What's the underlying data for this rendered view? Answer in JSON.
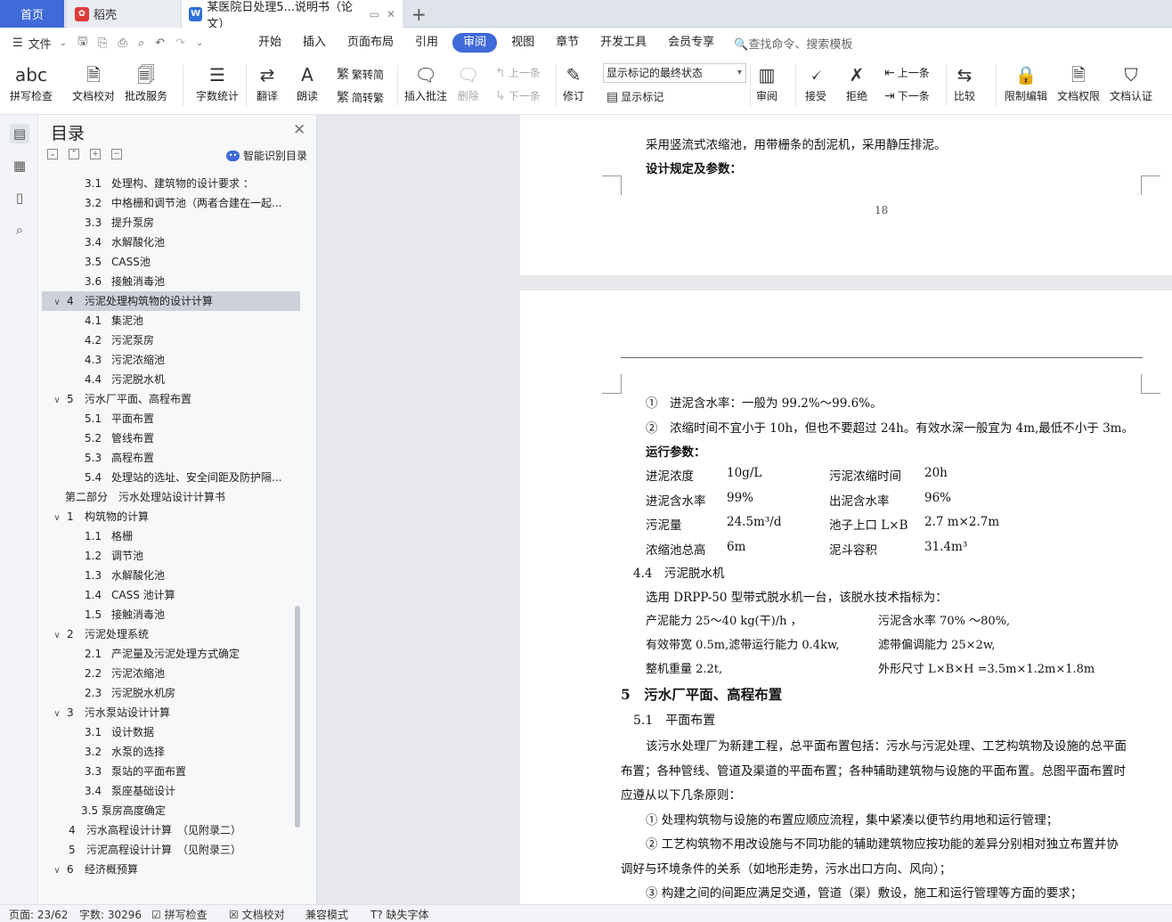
{
  "tabs": {
    "home": "首页",
    "daoke": "稻壳",
    "active": "某医院日处理5...说明书（论文）"
  },
  "menu": {
    "file": "文件",
    "items": [
      "开始",
      "插入",
      "页面布局",
      "引用",
      "审阅",
      "视图",
      "章节",
      "开发工具",
      "会员专享"
    ],
    "active_index": 4,
    "search": "查找命令、搜索模板"
  },
  "ribbon": {
    "spell": "拼写检查",
    "doc_check": "文档校对",
    "batch": "批改服务",
    "wordcount": "字数统计",
    "translate": "翻译",
    "read": "朗读",
    "t2s": "繁转简",
    "s2t": "简转繁",
    "insert_comment": "插入批注",
    "delete": "删除",
    "prev_comment": "上一条",
    "next_comment": "下一条",
    "revise": "修订",
    "markup_state": "显示标记的最终状态",
    "show_markup": "显示标记",
    "review": "审阅",
    "accept": "接受",
    "reject": "拒绝",
    "prev_change": "上一条",
    "next_change": "下一条",
    "compare": "比较",
    "restrict": "限制编辑",
    "permission": "文档权限",
    "certify": "文档认证"
  },
  "toc": {
    "title": "目录",
    "smart": "智能识别目录",
    "items": [
      {
        "num": "3.1",
        "text": "处理构、建筑物的设计要求 ：",
        "level": 3
      },
      {
        "num": "3.2",
        "text": "中格栅和调节池（两者合建在一起...",
        "level": 3
      },
      {
        "num": "3.3",
        "text": "提升泵房",
        "level": 3
      },
      {
        "num": "3.4",
        "text": "水解酸化池",
        "level": 3
      },
      {
        "num": "3.5",
        "text": "CASS池",
        "level": 3
      },
      {
        "num": "3.6",
        "text": "接触消毒池",
        "level": 3
      },
      {
        "num": "4",
        "text": "污泥处理构筑物的设计计算",
        "level": 2,
        "toggle": "v",
        "selected": true
      },
      {
        "num": "4.1",
        "text": "集泥池",
        "level": 3
      },
      {
        "num": "4.2",
        "text": "污泥泵房",
        "level": 3
      },
      {
        "num": "4.3",
        "text": "污泥浓缩池",
        "level": 3
      },
      {
        "num": "4.4",
        "text": "污泥脱水机",
        "level": 3
      },
      {
        "num": "5",
        "text": "污水厂平面、高程布置",
        "level": 2,
        "toggle": "v"
      },
      {
        "num": "5.1",
        "text": "平面布置",
        "level": 3
      },
      {
        "num": "5.2",
        "text": "管线布置",
        "level": 3
      },
      {
        "num": "5.3",
        "text": "高程布置",
        "level": 3
      },
      {
        "num": "5.4",
        "text": "处理站的选址、安全间距及防护隔...",
        "level": 3
      },
      {
        "num": "",
        "text": "第二部分　污水处理站设计计算书",
        "level": 1
      },
      {
        "num": "1",
        "text": "构筑物的计算",
        "level": 2,
        "toggle": "v"
      },
      {
        "num": "1.1",
        "text": "格栅",
        "level": 3
      },
      {
        "num": "1.2",
        "text": "调节池",
        "level": 3
      },
      {
        "num": "1.3",
        "text": "水解酸化池",
        "level": 3
      },
      {
        "num": "1.4",
        "text": "CASS 池计算",
        "level": 3
      },
      {
        "num": "1.5",
        "text": "接触消毒池",
        "level": 3
      },
      {
        "num": "2",
        "text": "污泥处理系统",
        "level": 2,
        "toggle": "v"
      },
      {
        "num": "2.1",
        "text": "产泥量及污泥处理方式确定",
        "level": 3
      },
      {
        "num": "2.2",
        "text": "污泥浓缩池",
        "level": 3
      },
      {
        "num": "2.3",
        "text": "污泥脱水机房",
        "level": 3
      },
      {
        "num": "3",
        "text": "污水泵站设计计算",
        "level": 2,
        "toggle": "v"
      },
      {
        "num": "3.1",
        "text": "设计数据",
        "level": 3
      },
      {
        "num": "3.2",
        "text": "水泵的选择",
        "level": 3
      },
      {
        "num": "3.3",
        "text": "泵站的平面布置",
        "level": 3
      },
      {
        "num": "3.4",
        "text": "泵座基础设计",
        "level": 3
      },
      {
        "num": "",
        "text": "3.5 泵房高度确定",
        "level": 3
      },
      {
        "num": "4",
        "text": "污水高程设计计算　（见附录二）",
        "level": 2
      },
      {
        "num": "5",
        "text": "污泥高程设计计算　（见附录三）",
        "level": 2
      },
      {
        "num": "6",
        "text": "经济概预算",
        "level": 2,
        "toggle": "v"
      }
    ]
  },
  "doc": {
    "p1": [
      "采用竖流式浓缩池，用带栅条的刮泥机，采用静压排泥。",
      "设计规定及参数："
    ],
    "page_number": "18",
    "l1": "①　进泥含水率：一般为 99.2%～99.6%。",
    "l2": "②　浓缩时间不宜小于 10h，但也不要超过 24h。有效水深一般宜为 4m,最低不小于 3m。",
    "l3": "运行参数：",
    "params": [
      [
        "进泥浓度",
        "10g/L",
        "污泥浓缩时间",
        "20h"
      ],
      [
        "进泥含水率",
        "99%",
        "出泥含水率",
        "96%"
      ],
      [
        "污泥量",
        "24.5m³/d",
        "池子上口 L×B",
        "2.7 m×2.7m"
      ],
      [
        "浓缩池总高",
        "6m",
        "泥斗容积",
        "31.4m³"
      ]
    ],
    "h44": "4.4　污泥脱水机",
    "d1": "选用 DRPP-50 型带式脱水机一台，该脱水技术指标为：",
    "specs": [
      [
        "产泥能力 25～40 kg(干)/h ，",
        "污泥含水率 70% ～80%,"
      ],
      [
        "有效带宽 0.5m,滤带运行能力 0.4kw,",
        "滤带偏调能力 25×2w,"
      ],
      [
        "整机重量 2.2t,",
        "外形尺寸 L×B×H =3.5m×1.2m×1.8m"
      ]
    ],
    "h5": "5　污水厂平面、高程布置",
    "h51": "5.1　平面布置",
    "para": [
      "该污水处理厂为新建工程，总平面布置包括：污水与污泥处理、工艺构筑物及设施的总平面",
      "布置；各种管线、管道及渠道的平面布置；各种辅助建筑物与设施的平面布置。总图平面布置时",
      "应遵从以下几条原则：",
      "① 处理构筑物与设施的布置应顺应流程，集中紧凑以便节约用地和运行管理；",
      "② 工艺构筑物不用改设施与不同功能的辅助建筑物应按功能的差异分别相对独立布置并协",
      "调好与环境条件的关系（如地形走势，污水出口方向、风向）；",
      "③ 构建之间的间距应满足交通，管道（渠）敷设，施工和运行管理等方面的要求；"
    ]
  },
  "status": {
    "page": "页面: 23/62",
    "words": "字数: 30296",
    "spell": "拼写检查",
    "doccheck": "文档校对",
    "compat": "兼容模式",
    "missing_font": "缺失字体"
  }
}
